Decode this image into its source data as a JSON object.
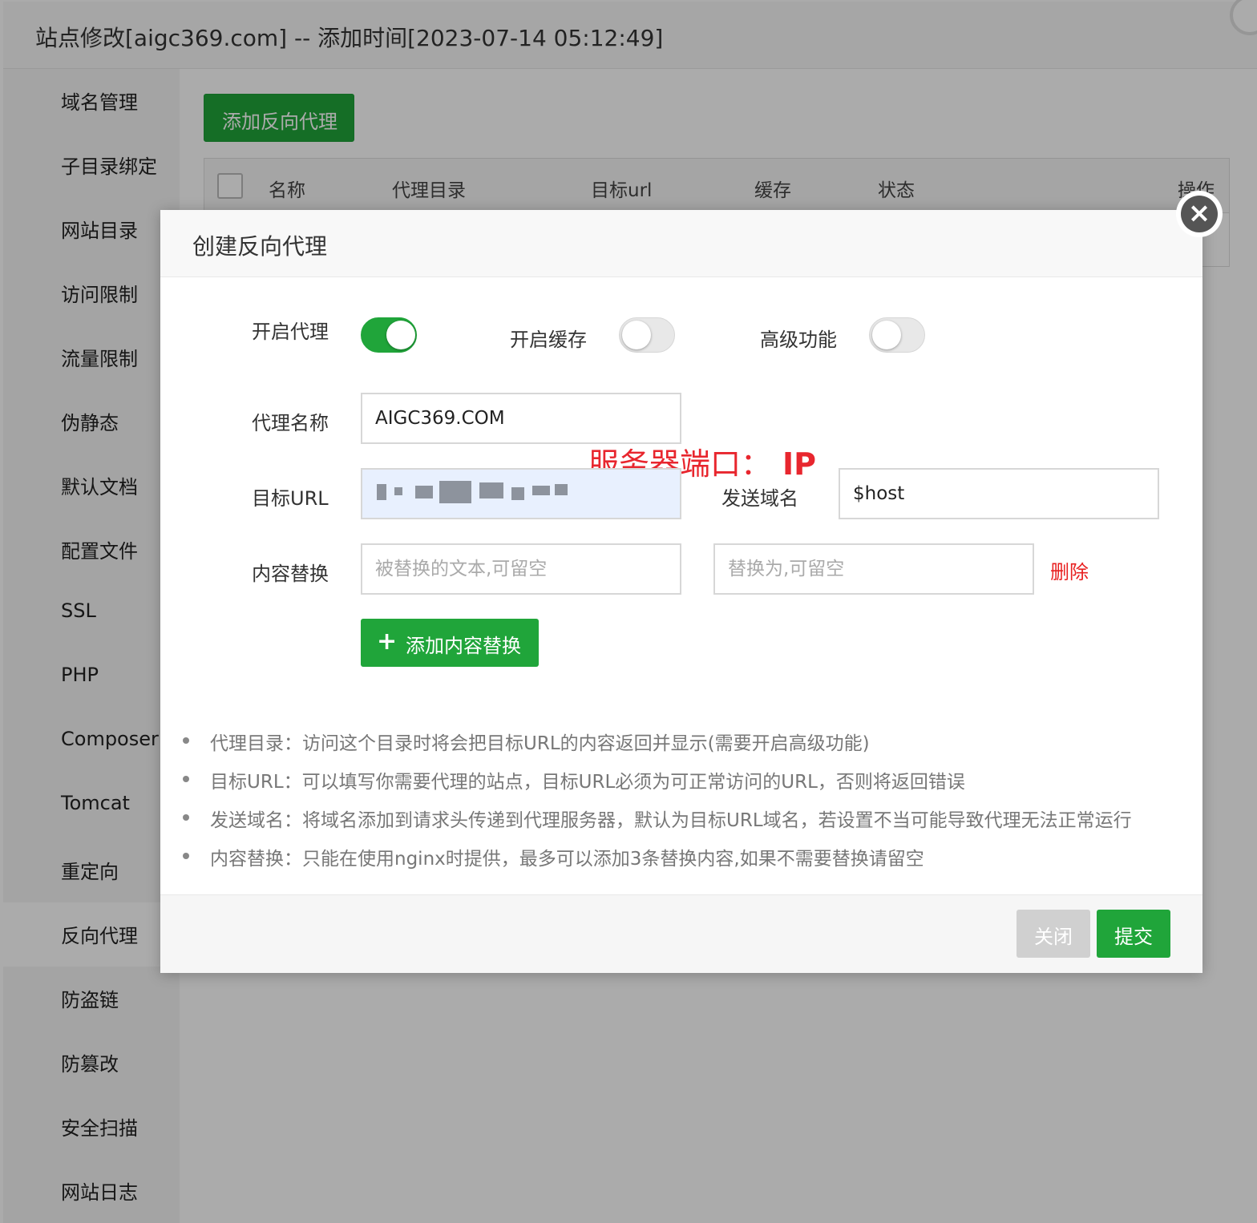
{
  "window": {
    "title": "站点修改[aigc369.com] -- 添加时间[2023-07-14 05:12:49]"
  },
  "sidebar": {
    "items": [
      {
        "label": "域名管理"
      },
      {
        "label": "子目录绑定"
      },
      {
        "label": "网站目录"
      },
      {
        "label": "访问限制"
      },
      {
        "label": "流量限制"
      },
      {
        "label": "伪静态"
      },
      {
        "label": "默认文档"
      },
      {
        "label": "配置文件"
      },
      {
        "label": "SSL"
      },
      {
        "label": "PHP"
      },
      {
        "label": "Composer"
      },
      {
        "label": "Tomcat"
      },
      {
        "label": "重定向"
      },
      {
        "label": "反向代理"
      },
      {
        "label": "防盗链"
      },
      {
        "label": "防篡改"
      },
      {
        "label": "安全扫描"
      },
      {
        "label": "网站日志"
      }
    ],
    "active": "反向代理"
  },
  "content": {
    "add_button": "添加反向代理",
    "table": {
      "columns": [
        "名称",
        "代理目录",
        "目标url",
        "缓存",
        "状态",
        "操作"
      ]
    }
  },
  "modal": {
    "title": "创建反向代理",
    "toggles": {
      "proxy": {
        "label": "开启代理",
        "on": true
      },
      "cache": {
        "label": "开启缓存",
        "on": false
      },
      "advanced": {
        "label": "高级功能",
        "on": false
      }
    },
    "proxy_name": {
      "label": "代理名称",
      "value": "AIGC369.COM"
    },
    "target_url": {
      "label": "目标URL",
      "value": ""
    },
    "send_domain": {
      "label": "发送域名",
      "value": "$host"
    },
    "annotation": {
      "text": "服务器端口：",
      "emphasis": "IP"
    },
    "content_replace": {
      "label": "内容替换",
      "from_placeholder": "被替换的文本,可留空",
      "to_placeholder": "替换为,可留空",
      "delete_label": "删除"
    },
    "add_replace_button": {
      "icon": "plus-icon",
      "label": "添加内容替换"
    },
    "tips": [
      "代理目录：访问这个目录时将会把目标URL的内容返回并显示(需要开启高级功能)",
      "目标URL：可以填写你需要代理的站点，目标URL必须为可正常访问的URL，否则将返回错误",
      "发送域名：将域名添加到请求头传递到代理服务器，默认为目标URL域名，若设置不当可能导致代理无法正常运行",
      "内容替换：只能在使用nginx时提供，最多可以添加3条替换内容,如果不需要替换请留空"
    ],
    "footer": {
      "close_label": "关闭",
      "submit_label": "提交"
    }
  },
  "colors": {
    "primary_green": "#20a53a",
    "danger_red": "#e82020",
    "annotation_red": "#e8262e"
  }
}
